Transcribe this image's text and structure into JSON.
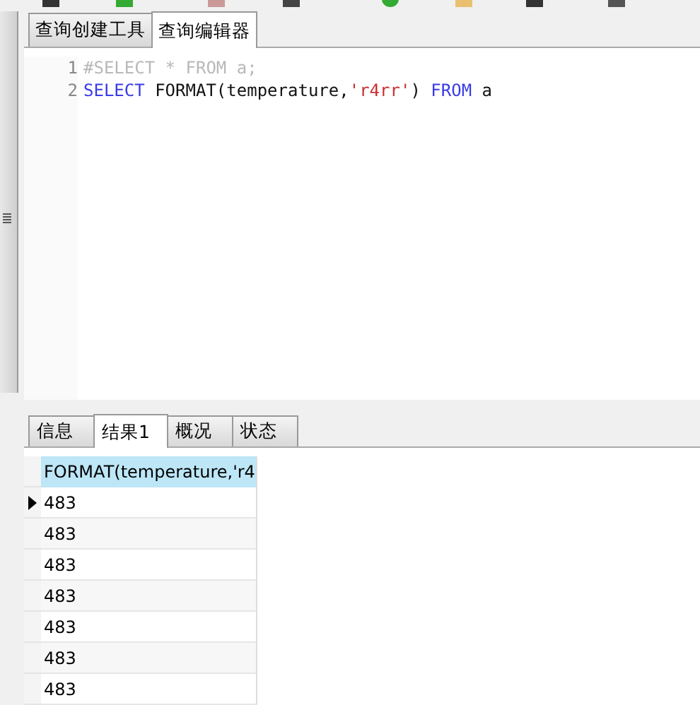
{
  "editor_tabs": [
    {
      "label": "查询创建工具",
      "selected": false
    },
    {
      "label": "查询编辑器",
      "selected": true
    }
  ],
  "code_lines": [
    {
      "number": "1",
      "tokens": [
        {
          "kind": "comment",
          "text": "#SELECT * FROM a;"
        }
      ]
    },
    {
      "number": "2",
      "tokens": [
        {
          "kind": "keyword",
          "text": "SELECT"
        },
        {
          "kind": "plain",
          "text": " FORMAT(temperature,"
        },
        {
          "kind": "string",
          "text": "'r4rr'"
        },
        {
          "kind": "plain",
          "text": ") "
        },
        {
          "kind": "keyword",
          "text": "FROM"
        },
        {
          "kind": "plain",
          "text": " a"
        }
      ]
    }
  ],
  "result_tabs": [
    {
      "label": "信息",
      "selected": false
    },
    {
      "label": "结果1",
      "selected": true
    },
    {
      "label": "概况",
      "selected": false
    },
    {
      "label": "状态",
      "selected": false
    }
  ],
  "table": {
    "columns": [
      "FORMAT(temperature,'r4"
    ],
    "rows": [
      {
        "cells": [
          "483"
        ],
        "current": true
      },
      {
        "cells": [
          "483"
        ],
        "current": false
      },
      {
        "cells": [
          "483"
        ],
        "current": false
      },
      {
        "cells": [
          "483"
        ],
        "current": false
      },
      {
        "cells": [
          "483"
        ],
        "current": false
      },
      {
        "cells": [
          "483"
        ],
        "current": false
      },
      {
        "cells": [
          "483"
        ],
        "current": false
      }
    ]
  }
}
